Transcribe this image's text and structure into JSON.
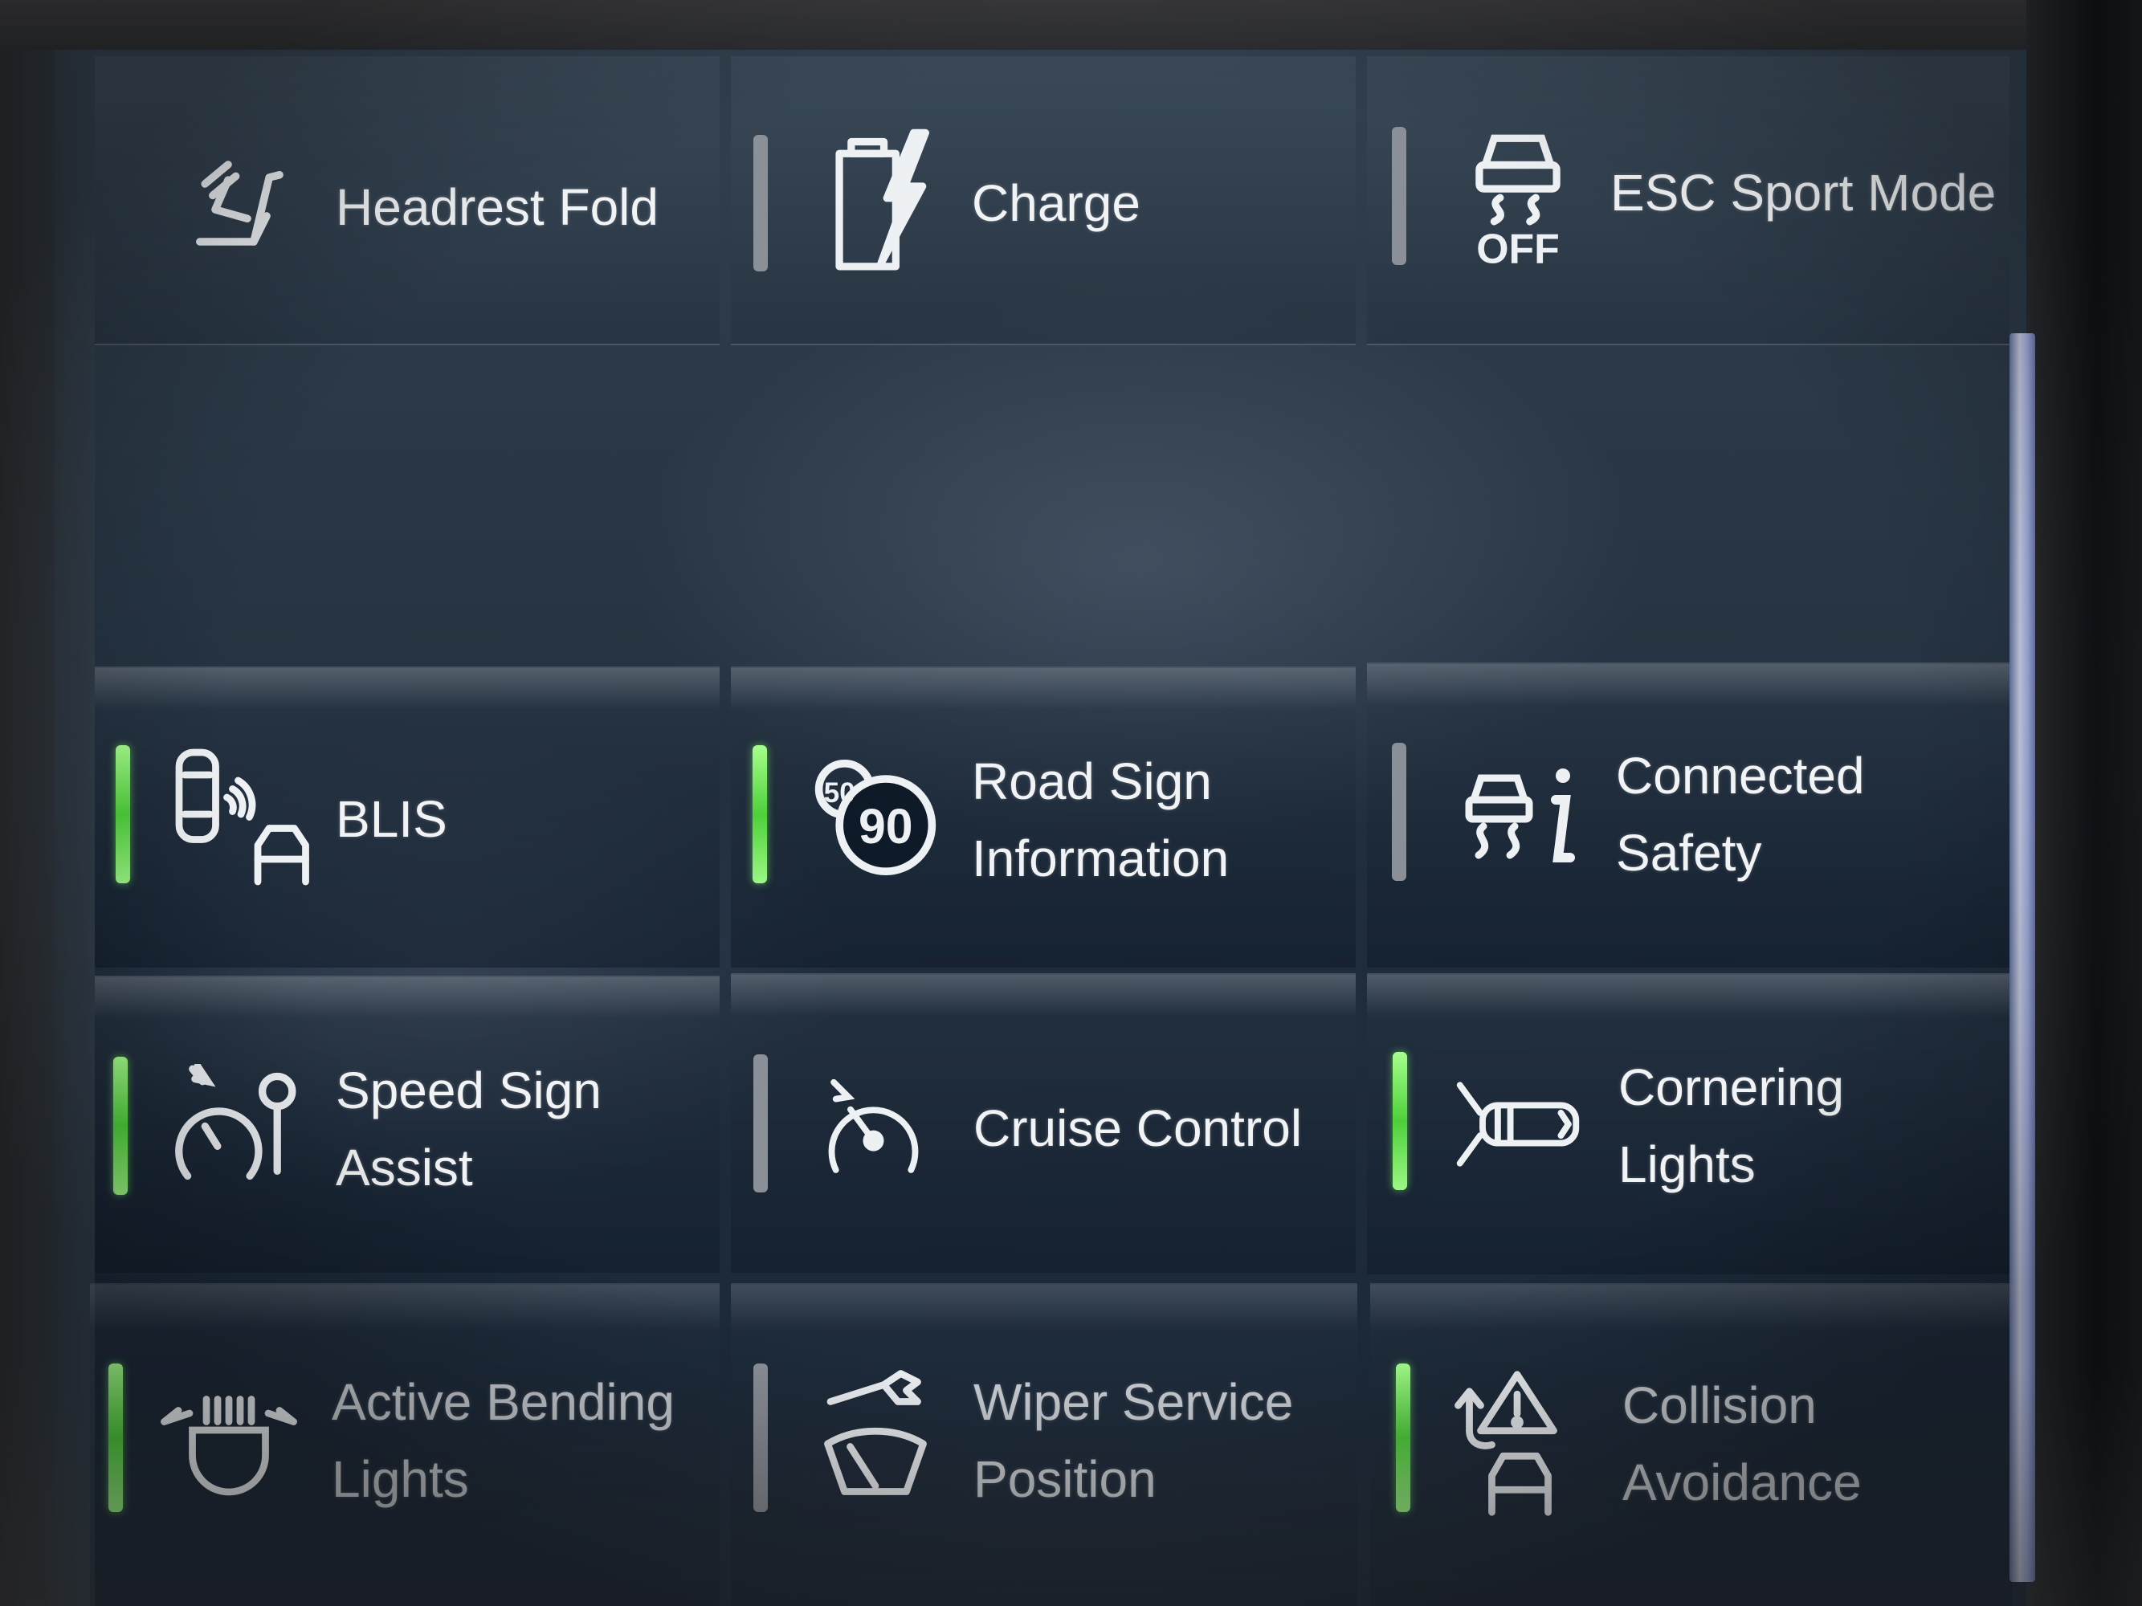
{
  "accent": {
    "on": "#4ed03a",
    "off": "#8b8f98",
    "text": "#f1f3f5"
  },
  "tiles": [
    {
      "lines": [
        "Headrest Fold"
      ],
      "icon": "headrest-fold-icon",
      "status": "none"
    },
    {
      "lines": [
        "Charge"
      ],
      "icon": "charge-icon",
      "status": "off"
    },
    {
      "lines": [
        "ESC Sport Mode"
      ],
      "icon": "esc-off-icon",
      "status": "off",
      "icon_text": "OFF"
    },
    {
      "lines": [
        "BLIS"
      ],
      "icon": "blind-spot-icon",
      "status": "on"
    },
    {
      "lines": [
        "Road Sign",
        "Information"
      ],
      "icon": "speed-sign-icon",
      "status": "on",
      "icon_text": [
        "50",
        "90"
      ]
    },
    {
      "lines": [
        "Connected",
        "Safety"
      ],
      "icon": "traction-info-icon",
      "status": "off"
    },
    {
      "lines": [
        "Speed Sign",
        "Assist"
      ],
      "icon": "speed-assist-icon",
      "status": "on"
    },
    {
      "lines": [
        "Cruise Control"
      ],
      "icon": "cruise-control-icon",
      "status": "off"
    },
    {
      "lines": [
        "Cornering",
        "Lights"
      ],
      "icon": "cornering-lights-icon",
      "status": "on"
    },
    {
      "lines": [
        "Active Bending",
        "Lights"
      ],
      "icon": "bending-lights-icon",
      "status": "on"
    },
    {
      "lines": [
        "Wiper Service",
        "Position"
      ],
      "icon": "wiper-service-icon",
      "status": "off"
    },
    {
      "lines": [
        "Collision",
        "Avoidance"
      ],
      "icon": "collision-avoidance-icon",
      "status": "on"
    }
  ]
}
